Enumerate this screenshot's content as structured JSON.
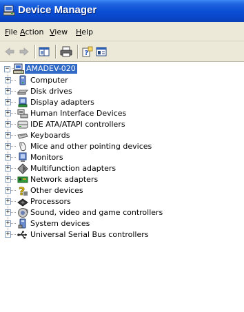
{
  "window": {
    "title": "Device Manager"
  },
  "menu": [
    {
      "key": "F",
      "rest": "ile"
    },
    {
      "key": "A",
      "rest": "ction"
    },
    {
      "key": "V",
      "rest": "iew"
    },
    {
      "key": "H",
      "rest": "elp"
    }
  ],
  "toolbar": {
    "buttons": [
      "back-icon",
      "forward-icon",
      "show-hide-console-tree-icon",
      "print-icon",
      "help-icon",
      "properties-icon"
    ]
  },
  "tree": {
    "root": {
      "label": "AMADEV-020",
      "icon": "computer-icon",
      "expanded": true
    },
    "items": [
      {
        "label": "Computer",
        "icon": "computer-icon"
      },
      {
        "label": "Disk drives",
        "icon": "disk-drive-icon"
      },
      {
        "label": "Display adapters",
        "icon": "display-adapter-icon"
      },
      {
        "label": "Human Interface Devices",
        "icon": "hid-icon"
      },
      {
        "label": "IDE ATA/ATAPI controllers",
        "icon": "ide-controller-icon"
      },
      {
        "label": "Keyboards",
        "icon": "keyboard-icon"
      },
      {
        "label": "Mice and other pointing devices",
        "icon": "mouse-icon"
      },
      {
        "label": "Monitors",
        "icon": "monitor-icon"
      },
      {
        "label": "Multifunction adapters",
        "icon": "multifunction-icon"
      },
      {
        "label": "Network adapters",
        "icon": "network-adapter-icon"
      },
      {
        "label": "Other devices",
        "icon": "unknown-device-icon"
      },
      {
        "label": "Processors",
        "icon": "processor-icon"
      },
      {
        "label": "Sound, video and game controllers",
        "icon": "sound-icon"
      },
      {
        "label": "System devices",
        "icon": "system-device-icon"
      },
      {
        "label": "Universal Serial Bus controllers",
        "icon": "usb-icon"
      }
    ]
  },
  "colors": {
    "titlebar": "#0b4fd6",
    "selection": "#316ac5",
    "chrome": "#ece9d8"
  }
}
